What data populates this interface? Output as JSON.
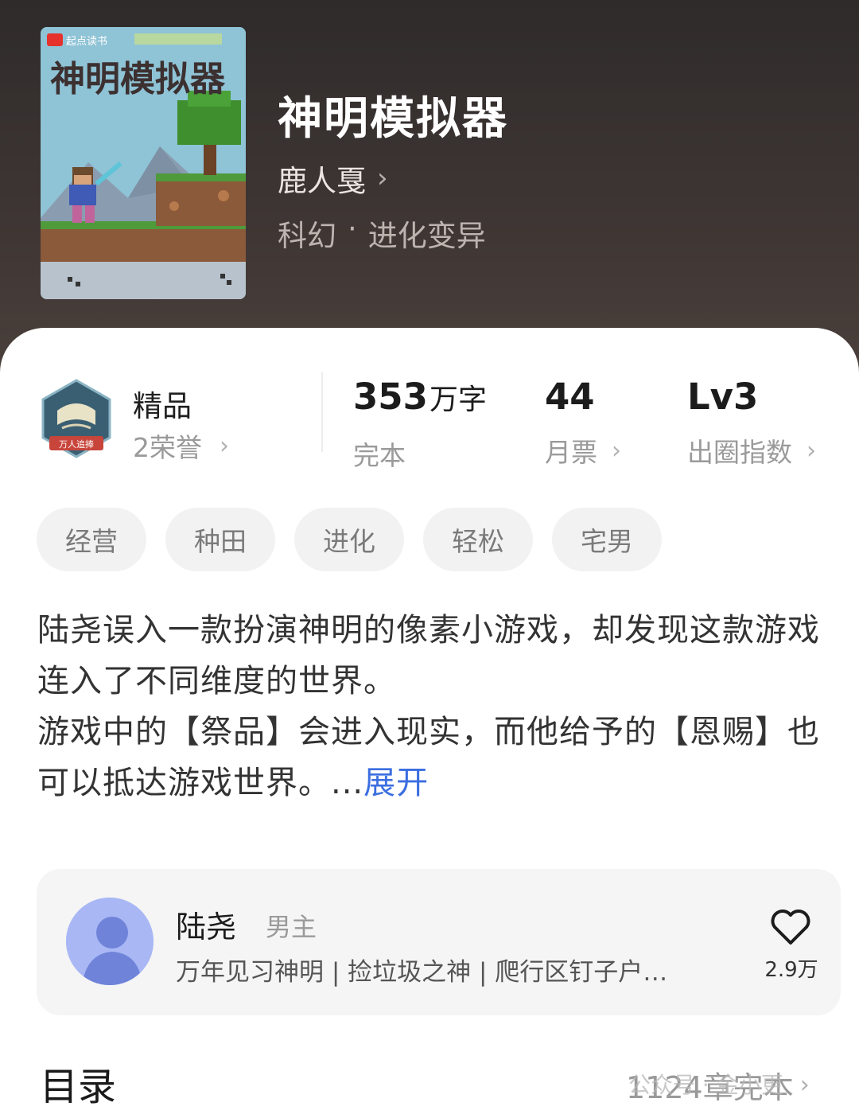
{
  "book": {
    "cover_brand": "起点读书",
    "cover_title": "神明模拟器",
    "title": "神明模拟器",
    "author": "鹿人戛",
    "genre_main": "科幻",
    "genre_sep": "·",
    "genre_sub": "进化变异"
  },
  "honor": {
    "badge_text": "万人追捧",
    "title": "精品",
    "subtitle": "2荣誉"
  },
  "stats": {
    "words_value": "353",
    "words_unit": "万字",
    "words_label": "完本",
    "votes_value": "44",
    "votes_label": "月票",
    "circle_value": "Lv3",
    "circle_label": "出圈指数"
  },
  "tags": [
    "经营",
    "种田",
    "进化",
    "轻松",
    "宅男"
  ],
  "description": {
    "line1": "陆尧误入一款扮演神明的像素小游戏，却发现这款游戏连入了不同维度的世界。",
    "line2": "游戏中的【祭品】会进入现实，而他给予的【恩赐】也可以抵达游戏世界。...",
    "expand": "展开"
  },
  "character": {
    "name": "陆尧",
    "role": "男主",
    "desc": "万年见习神明 | 捡垃圾之神 | 爬行区钉子户…",
    "likes": "2.9万"
  },
  "toc": {
    "title": "目录",
    "info": "1124章完本"
  },
  "watermark": "公众号 · 金小更",
  "icons": {
    "chevron": "chevron-right-icon",
    "heart": "heart-icon"
  },
  "colors": {
    "accent_link": "#3b6ee0",
    "header_bg": "#3a3331"
  }
}
